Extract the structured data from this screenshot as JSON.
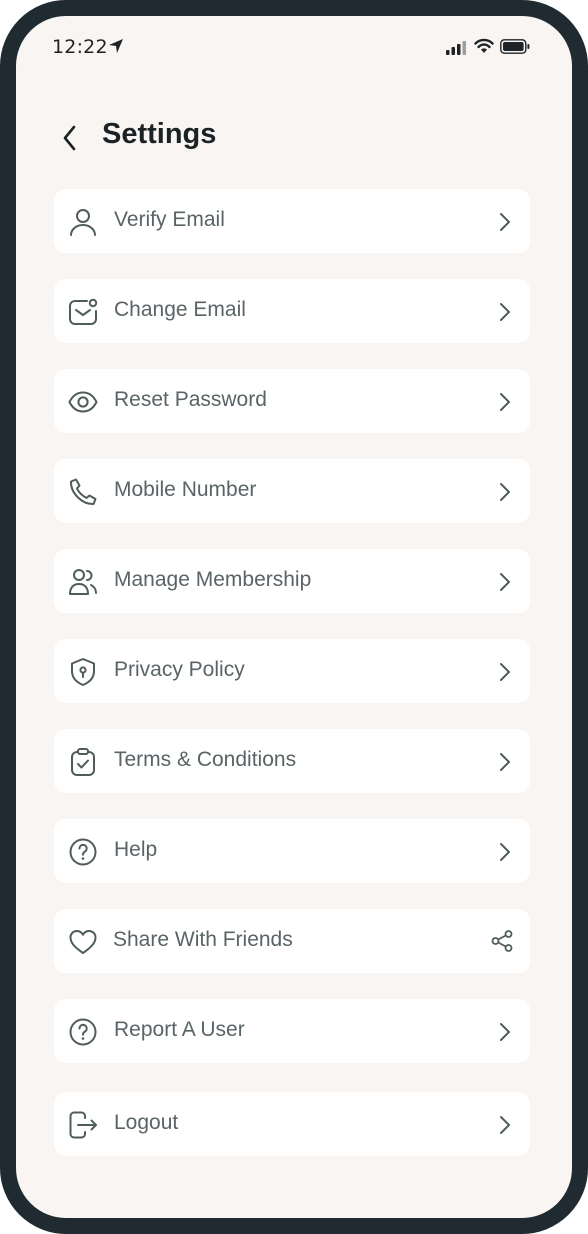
{
  "status_bar": {
    "time": "12:22"
  },
  "header": {
    "title": "Settings"
  },
  "menu": [
    {
      "label": "Verify Email",
      "icon": "user-icon",
      "trailing": "chevron-right-icon"
    },
    {
      "label": "Change Email",
      "icon": "mail-notification-icon",
      "trailing": "chevron-right-icon"
    },
    {
      "label": "Reset Password",
      "icon": "eye-icon",
      "trailing": "chevron-right-icon"
    },
    {
      "label": "Mobile Number",
      "icon": "phone-icon",
      "trailing": "chevron-right-icon"
    },
    {
      "label": "Manage Membership",
      "icon": "users-icon",
      "trailing": "chevron-right-icon"
    },
    {
      "label": "Privacy Policy",
      "icon": "shield-icon",
      "trailing": "chevron-right-icon"
    },
    {
      "label": "Terms & Conditions",
      "icon": "clipboard-check-icon",
      "trailing": "chevron-right-icon"
    },
    {
      "label": "Help",
      "icon": "question-circle-icon",
      "trailing": "chevron-right-icon"
    },
    {
      "label": "Share With Friends",
      "icon": "heart-icon",
      "trailing": "share-icon"
    },
    {
      "label": "Report A User",
      "icon": "question-circle-icon",
      "trailing": "chevron-right-icon"
    },
    {
      "label": "Logout",
      "icon": "logout-icon",
      "trailing": "chevron-right-icon"
    }
  ],
  "colors": {
    "frame": "#1f2b31",
    "background": "#f8f5f2",
    "card": "#ffffff",
    "icon": "#4f5d58",
    "text": "#5a6466"
  }
}
